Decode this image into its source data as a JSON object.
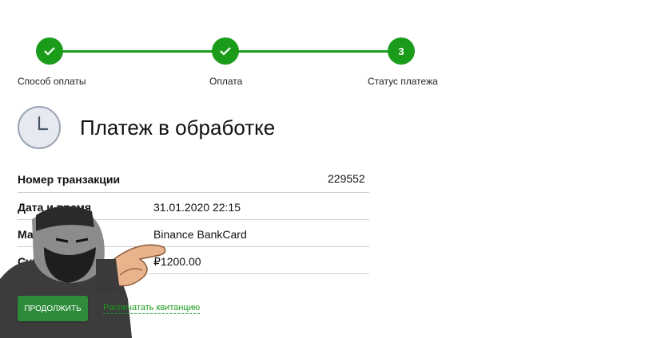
{
  "stepper": {
    "steps": [
      {
        "label": "Способ оплаты",
        "state": "done"
      },
      {
        "label": "Оплата",
        "state": "done"
      },
      {
        "label": "Статус платежа",
        "state": "current",
        "number": "3"
      }
    ],
    "color": "#1a9c1a"
  },
  "status": {
    "title": "Платеж в обработке",
    "icon": "clock-icon"
  },
  "details": [
    {
      "key": "Номер транзакции",
      "value": "229552"
    },
    {
      "key": "Дата и время",
      "value": "31.01.2020 22:15"
    },
    {
      "key": "Магазин",
      "value": "Binance BankCard"
    },
    {
      "key": "Сумма платежа",
      "value": "₽1200.00"
    }
  ],
  "actions": {
    "continue_label": "продолжить",
    "receipt_link": "Распечатать квитанцию"
  }
}
